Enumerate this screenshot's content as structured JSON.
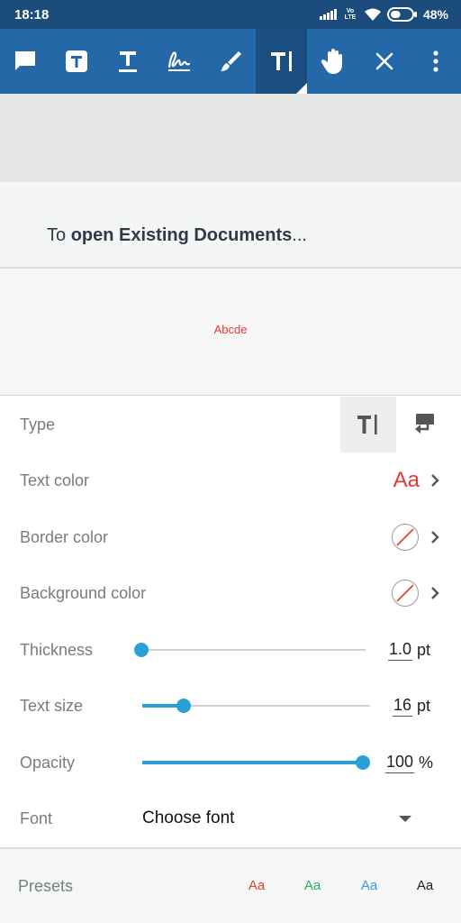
{
  "status_bar": {
    "time": "18:18",
    "network_label": "Vo LTE",
    "battery_percent": "48%",
    "battery_level": 0.48
  },
  "toolbar": {
    "tools": [
      {
        "name": "comment-icon"
      },
      {
        "name": "text-box-icon"
      },
      {
        "name": "text-underline-icon"
      },
      {
        "name": "signature-icon"
      },
      {
        "name": "brush-icon"
      },
      {
        "name": "free-text-icon",
        "active": true
      },
      {
        "name": "hand-pan-icon"
      },
      {
        "name": "close-icon"
      },
      {
        "name": "more-vertical-icon"
      }
    ]
  },
  "document": {
    "text_prefix": "To ",
    "text_bold": "open Existing Documents",
    "text_suffix": "...",
    "annotation_text": "Abcde"
  },
  "panel": {
    "type": {
      "label": "Type",
      "options": [
        "free-text-icon",
        "callout-icon"
      ],
      "selected": 0
    },
    "text_color": {
      "label": "Text color",
      "preview": "Aa",
      "color": "#e53935"
    },
    "border_color": {
      "label": "Border color",
      "value": "none"
    },
    "background_color": {
      "label": "Background color",
      "value": "none"
    },
    "thickness": {
      "label": "Thickness",
      "value": "1.0",
      "unit": "pt",
      "fraction": 0.0
    },
    "text_size": {
      "label": "Text size",
      "value": "16",
      "unit": "pt",
      "fraction": 0.18
    },
    "opacity": {
      "label": "Opacity",
      "value": "100",
      "unit": "%",
      "fraction": 1.0
    },
    "font": {
      "label": "Font",
      "value": "Choose font"
    }
  },
  "presets": {
    "label": "Presets",
    "items": [
      {
        "text": "Aa",
        "color": "#e53935"
      },
      {
        "text": "Aa",
        "color": "#27ae60"
      },
      {
        "text": "Aa",
        "color": "#3a9ad9"
      },
      {
        "text": "Aa",
        "color": "#222222"
      }
    ]
  },
  "colors": {
    "toolbar": "#2468a8",
    "status_bar": "#1c4c7c",
    "accent": "#2b9fd8"
  }
}
